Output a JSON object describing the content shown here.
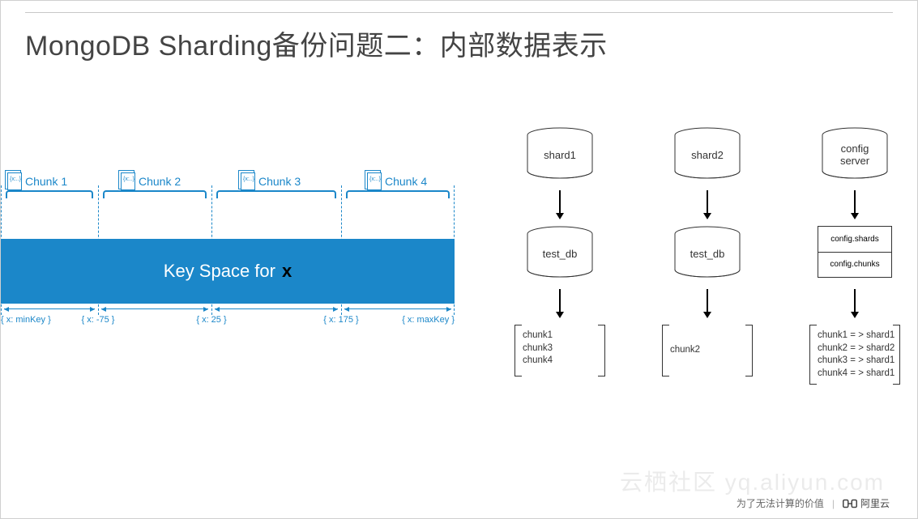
{
  "title": "MongoDB Sharding备份问题二：内部数据表示",
  "keyspace": {
    "label_prefix": "Key Space for",
    "var": "x",
    "chunks": [
      "Chunk 1",
      "Chunk 2",
      "Chunk 3",
      "Chunk 4"
    ],
    "ticks": [
      "{ x: minKey }",
      "{ x: -75 }",
      "{ x: 25 }",
      "{ x: 175 }",
      "{ x: maxKey }"
    ]
  },
  "columns": [
    {
      "top": "shard1",
      "mid_type": "cyl",
      "mid": "test_db",
      "bottom": [
        "chunk1",
        "chunk3",
        "chunk4"
      ]
    },
    {
      "top": "shard2",
      "mid_type": "cyl",
      "mid": "test_db",
      "bottom": [
        "chunk2"
      ]
    },
    {
      "top": "config\nserver",
      "mid_type": "table",
      "mid_rows": [
        "config.shards",
        "config.chunks"
      ],
      "bottom": [
        "chunk1 = > shard1",
        "chunk2 = > shard2",
        "chunk3 = > shard1",
        "chunk4 = > shard1"
      ]
    }
  ],
  "footer": {
    "text": "为了无法计算的价值",
    "brand": "阿里云"
  },
  "watermark": "云栖社区  yq.aliyun.com",
  "chart_data": {
    "type": "diagram",
    "title": "MongoDB Sharding internal data representation",
    "key_space_variable": "x",
    "key_breakpoints": [
      "minKey",
      -75,
      25,
      175,
      "maxKey"
    ],
    "chunks": [
      {
        "name": "Chunk 1",
        "range": [
          "minKey",
          -75
        ]
      },
      {
        "name": "Chunk 2",
        "range": [
          -75,
          25
        ]
      },
      {
        "name": "Chunk 3",
        "range": [
          25,
          175
        ]
      },
      {
        "name": "Chunk 4",
        "range": [
          175,
          "maxKey"
        ]
      }
    ],
    "shards": [
      {
        "name": "shard1",
        "db": "test_db",
        "chunks": [
          "chunk1",
          "chunk3",
          "chunk4"
        ]
      },
      {
        "name": "shard2",
        "db": "test_db",
        "chunks": [
          "chunk2"
        ]
      }
    ],
    "config_server": {
      "collections": [
        "config.shards",
        "config.chunks"
      ],
      "chunk_map": {
        "chunk1": "shard1",
        "chunk2": "shard2",
        "chunk3": "shard1",
        "chunk4": "shard1"
      }
    }
  }
}
